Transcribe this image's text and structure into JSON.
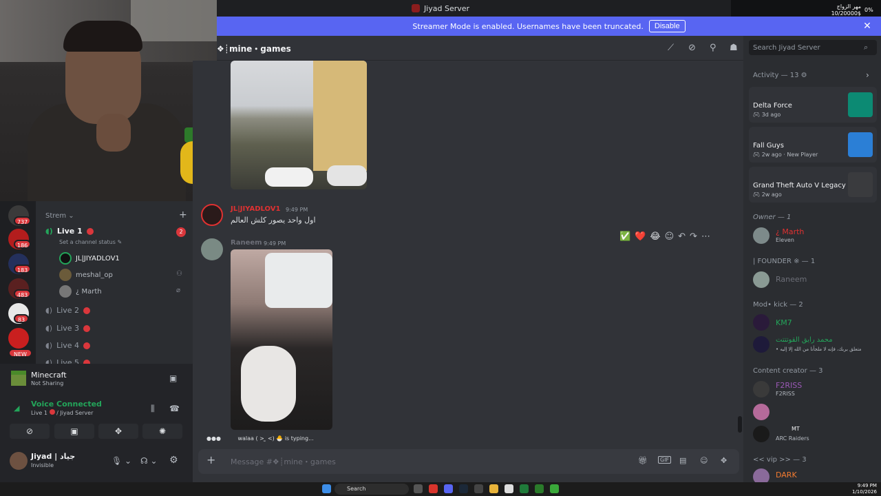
{
  "window": {
    "title": "Jiyad Server"
  },
  "overlay": {
    "goal_label": "مهر الزواج",
    "goal_progress": "10/20000$",
    "percent": "0%"
  },
  "banner": {
    "text": "Streamer Mode is enabled. Usernames have been truncated.",
    "disable_label": "Disable"
  },
  "servers": [
    {
      "badge": "737"
    },
    {
      "badge": "186"
    },
    {
      "badge": "183"
    },
    {
      "badge": "483"
    },
    {
      "badge": "83"
    },
    {
      "badge": "NEW"
    }
  ],
  "channels": {
    "category": "Strem",
    "active": {
      "name": "Live 1",
      "status_placeholder": "Set a channel status",
      "badge": "2"
    },
    "voice_users": [
      "JL|JIYADLOV1",
      "meshal_op",
      "¿ Marth"
    ],
    "others": [
      "Live 2",
      "Live 3",
      "Live 4",
      "Live 5"
    ]
  },
  "user_panel": {
    "activity_name": "Minecraft",
    "activity_status": "Not Sharing",
    "voice_status": "Voice Connected",
    "voice_channel": "Live 1",
    "voice_server": "/ Jiyad Server",
    "username": "Jiyad | جياد",
    "user_status": "Invisible"
  },
  "chat": {
    "channel_name": "mine・games",
    "messages": [
      {
        "author": "JL|JIYADLOV1",
        "time": "9:49 PM",
        "text": "اول واحد يصور كلش العالم",
        "author_color": "#e03131"
      },
      {
        "author": "Raneem",
        "time": "9:49 PM",
        "text": "",
        "author_color": "#6d6f78"
      }
    ],
    "typing": "walaa ( > ̫ <) 🐣 is typing...",
    "composer_placeholder": "Message #❖┊mine・games",
    "reactions": [
      "✅",
      "❤️",
      "😂"
    ]
  },
  "members": {
    "search_placeholder": "Search Jiyad Server",
    "activity_header": "Activity — 13",
    "activities": [
      {
        "game": "Delta Force",
        "sub": "3d ago",
        "extra": "",
        "color": "#0c8a73"
      },
      {
        "game": "Fall Guys",
        "sub": "2w ago",
        "extra": "New Player",
        "color": "#2b7fd6"
      },
      {
        "game": "Grand Theft Auto V Legacy",
        "sub": "2w ago",
        "extra": "",
        "color": "#3a3b3e"
      }
    ],
    "sections": [
      {
        "title": "Owner — 1",
        "members": [
          {
            "name": "¿ Marth",
            "sub": "Eleven",
            "color": "#e03131"
          }
        ]
      },
      {
        "title": "| FOUNDER ※ — 1",
        "members": [
          {
            "name": "Raneem",
            "sub": "",
            "color": "#6d6f78"
          }
        ]
      },
      {
        "title": "Mod• kick — 2",
        "members": [
          {
            "name": "KM7",
            "sub": "",
            "color": "#23a55a"
          },
          {
            "name": "محمد رايق القوتتتت",
            "sub": "• متعلق بربك، فإنه لا ملجأنا من الله إلا إليه",
            "color": "#23a55a"
          }
        ]
      },
      {
        "title": "Content creator — 3",
        "members": [
          {
            "name": "F2RISS",
            "sub": "F2RISS",
            "color": "#9b59b6"
          },
          {
            "name": "",
            "sub": "",
            "color": "#9b59b6"
          },
          {
            "name": "MT",
            "sub": "ARC Raiders",
            "color": "#9b59b6"
          }
        ]
      },
      {
        "title": "<< vip >> — 3",
        "members": [
          {
            "name": "DARK",
            "sub": "",
            "color": "#f47b30"
          }
        ]
      }
    ]
  },
  "taskbar": {
    "search_label": "Search",
    "time": "9:49 PM",
    "date": "1/10/2026"
  }
}
